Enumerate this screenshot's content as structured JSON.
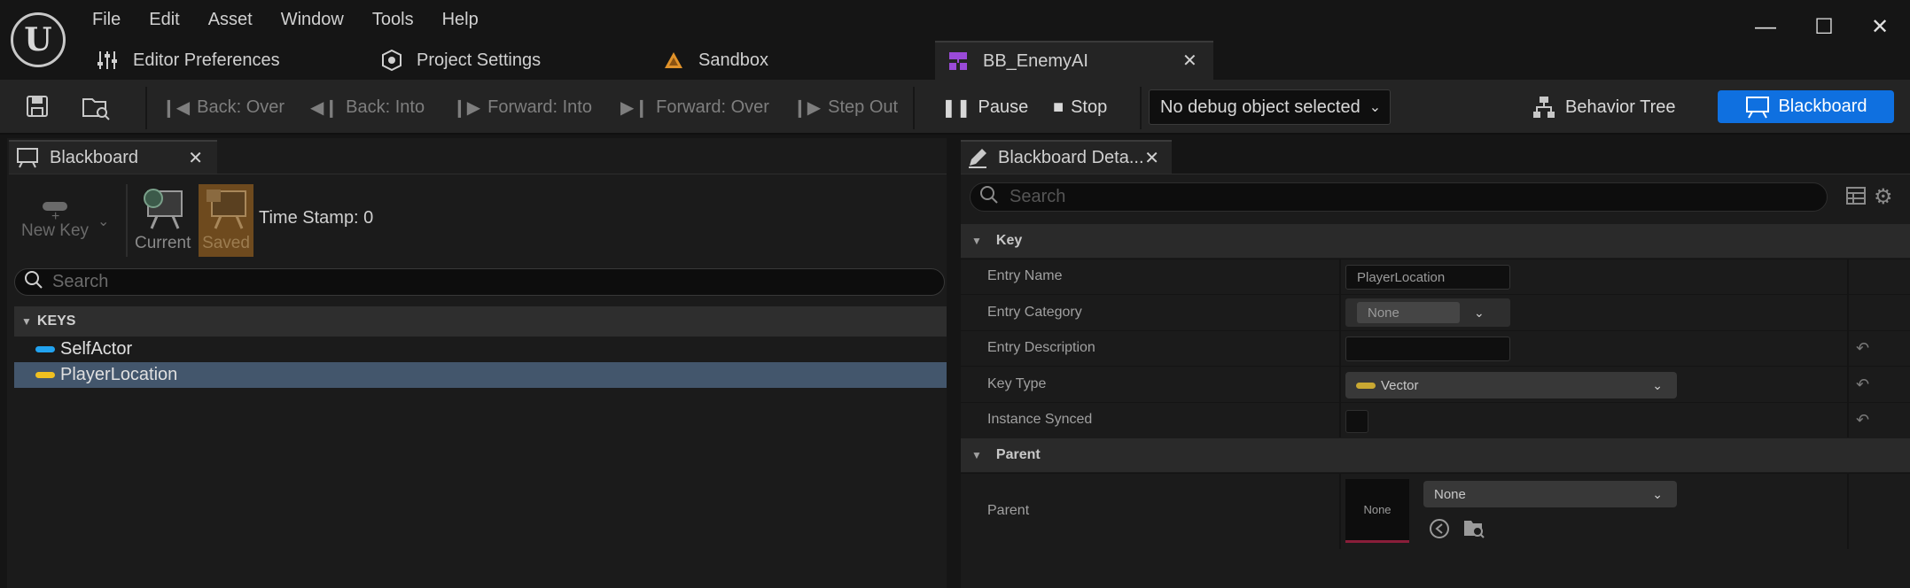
{
  "app": {
    "menu": [
      "File",
      "Edit",
      "Asset",
      "Window",
      "Tools",
      "Help"
    ],
    "tabs": [
      {
        "label": "Editor Preferences",
        "icon": "sliders-icon"
      },
      {
        "label": "Project Settings",
        "icon": "gear-cube-icon"
      },
      {
        "label": "Sandbox",
        "icon": "level-icon"
      },
      {
        "label": "BB_EnemyAI",
        "icon": "blackboard-asset-icon",
        "active": true
      }
    ],
    "window_controls": [
      "minimize",
      "maximize",
      "close"
    ]
  },
  "toolbar": {
    "save_icon": "save-icon",
    "browse_icon": "browse-icon",
    "back_over": "Back: Over",
    "back_into": "Back: Into",
    "forward_into": "Forward: Into",
    "forward_over": "Forward: Over",
    "step_out": "Step Out",
    "pause": "Pause",
    "stop": "Stop",
    "debug_object": "No debug object selected",
    "behavior_tree": "Behavior Tree",
    "blackboard": "Blackboard"
  },
  "left_panel": {
    "tab_label": "Blackboard",
    "new_key": "New Key",
    "current": "Current",
    "saved": "Saved",
    "timestamp": "Time Stamp: 0",
    "search_placeholder": "Search",
    "keys_header": "KEYS",
    "keys": [
      {
        "label": "SelfActor",
        "color": "#22a3f0"
      },
      {
        "label": "PlayerLocation",
        "color": "#f0c020",
        "selected": true
      }
    ]
  },
  "right_panel": {
    "tab_label": "Blackboard Deta...",
    "search_placeholder": "Search",
    "key_category": "Key",
    "parent_category": "Parent",
    "props": {
      "entry_name_label": "Entry Name",
      "entry_name_value": "PlayerLocation",
      "entry_category_label": "Entry Category",
      "entry_category_value": "None",
      "entry_description_label": "Entry Description",
      "entry_description_value": "",
      "key_type_label": "Key Type",
      "key_type_value": "Vector",
      "key_type_color": "#c9a832",
      "instance_synced_label": "Instance Synced",
      "parent_label": "Parent",
      "parent_thumb": "None",
      "parent_value": "None"
    }
  },
  "colors": {
    "accent_blue": "#0f70e0",
    "selection": "#43566c",
    "saved_bg": "#6e4a1e"
  }
}
